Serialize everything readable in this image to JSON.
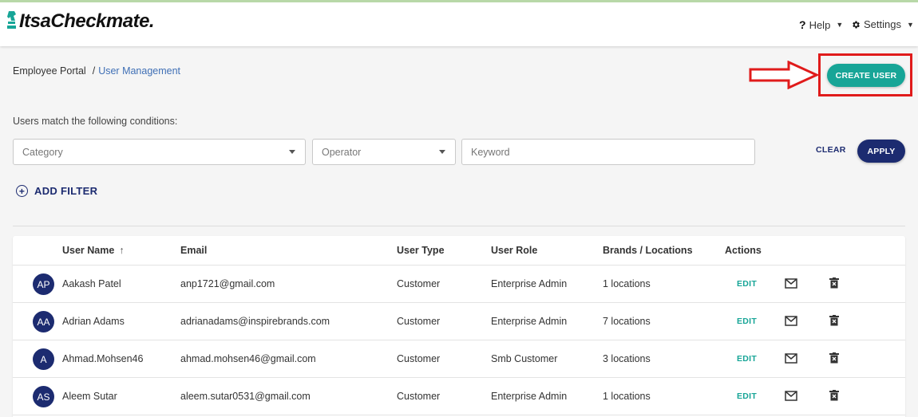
{
  "app": {
    "logo_text": "ItsaCheckmate."
  },
  "topnav": {
    "help_label": "Help",
    "settings_label": "Settings"
  },
  "breadcrumb": {
    "root": "Employee Portal",
    "separator": "/",
    "current": "User Management"
  },
  "create_user_label": "CREATE USER",
  "filters": {
    "conditions_label": "Users match the following conditions:",
    "category_placeholder": "Category",
    "operator_placeholder": "Operator",
    "keyword_placeholder": "Keyword",
    "clear_label": "CLEAR",
    "apply_label": "APPLY",
    "add_filter_label": "ADD FILTER"
  },
  "table": {
    "headers": {
      "user_name": "User Name",
      "sort_icon": "↑",
      "email": "Email",
      "user_type": "User Type",
      "user_role": "User Role",
      "brands": "Brands / Locations",
      "actions": "Actions"
    },
    "rows": [
      {
        "initials": "AP",
        "name": "Aakash Patel",
        "email": "anp1721@gmail.com",
        "type": "Customer",
        "role": "Enterprise Admin",
        "locations": "1 locations",
        "edit": "EDIT"
      },
      {
        "initials": "AA",
        "name": "Adrian Adams",
        "email": "adrianadams@inspirebrands.com",
        "type": "Customer",
        "role": "Enterprise Admin",
        "locations": "7 locations",
        "edit": "EDIT"
      },
      {
        "initials": "A",
        "name": "Ahmad.Mohsen46",
        "email": "ahmad.mohsen46@gmail.com",
        "type": "Customer",
        "role": "Smb Customer",
        "locations": "3 locations",
        "edit": "EDIT"
      },
      {
        "initials": "AS",
        "name": "Aleem Sutar",
        "email": "aleem.sutar0531@gmail.com",
        "type": "Customer",
        "role": "Enterprise Admin",
        "locations": "1 locations",
        "edit": "EDIT"
      }
    ]
  },
  "colors": {
    "primary": "#1c2b70",
    "accent": "#17a597",
    "highlight": "#e01b1b"
  },
  "icons": [
    "chess-knight-icon",
    "help-icon",
    "gear-icon",
    "caret-down-icon",
    "add-circle-icon",
    "sort-arrow-up-icon",
    "mail-icon",
    "trash-icon",
    "arrow-right-icon"
  ]
}
